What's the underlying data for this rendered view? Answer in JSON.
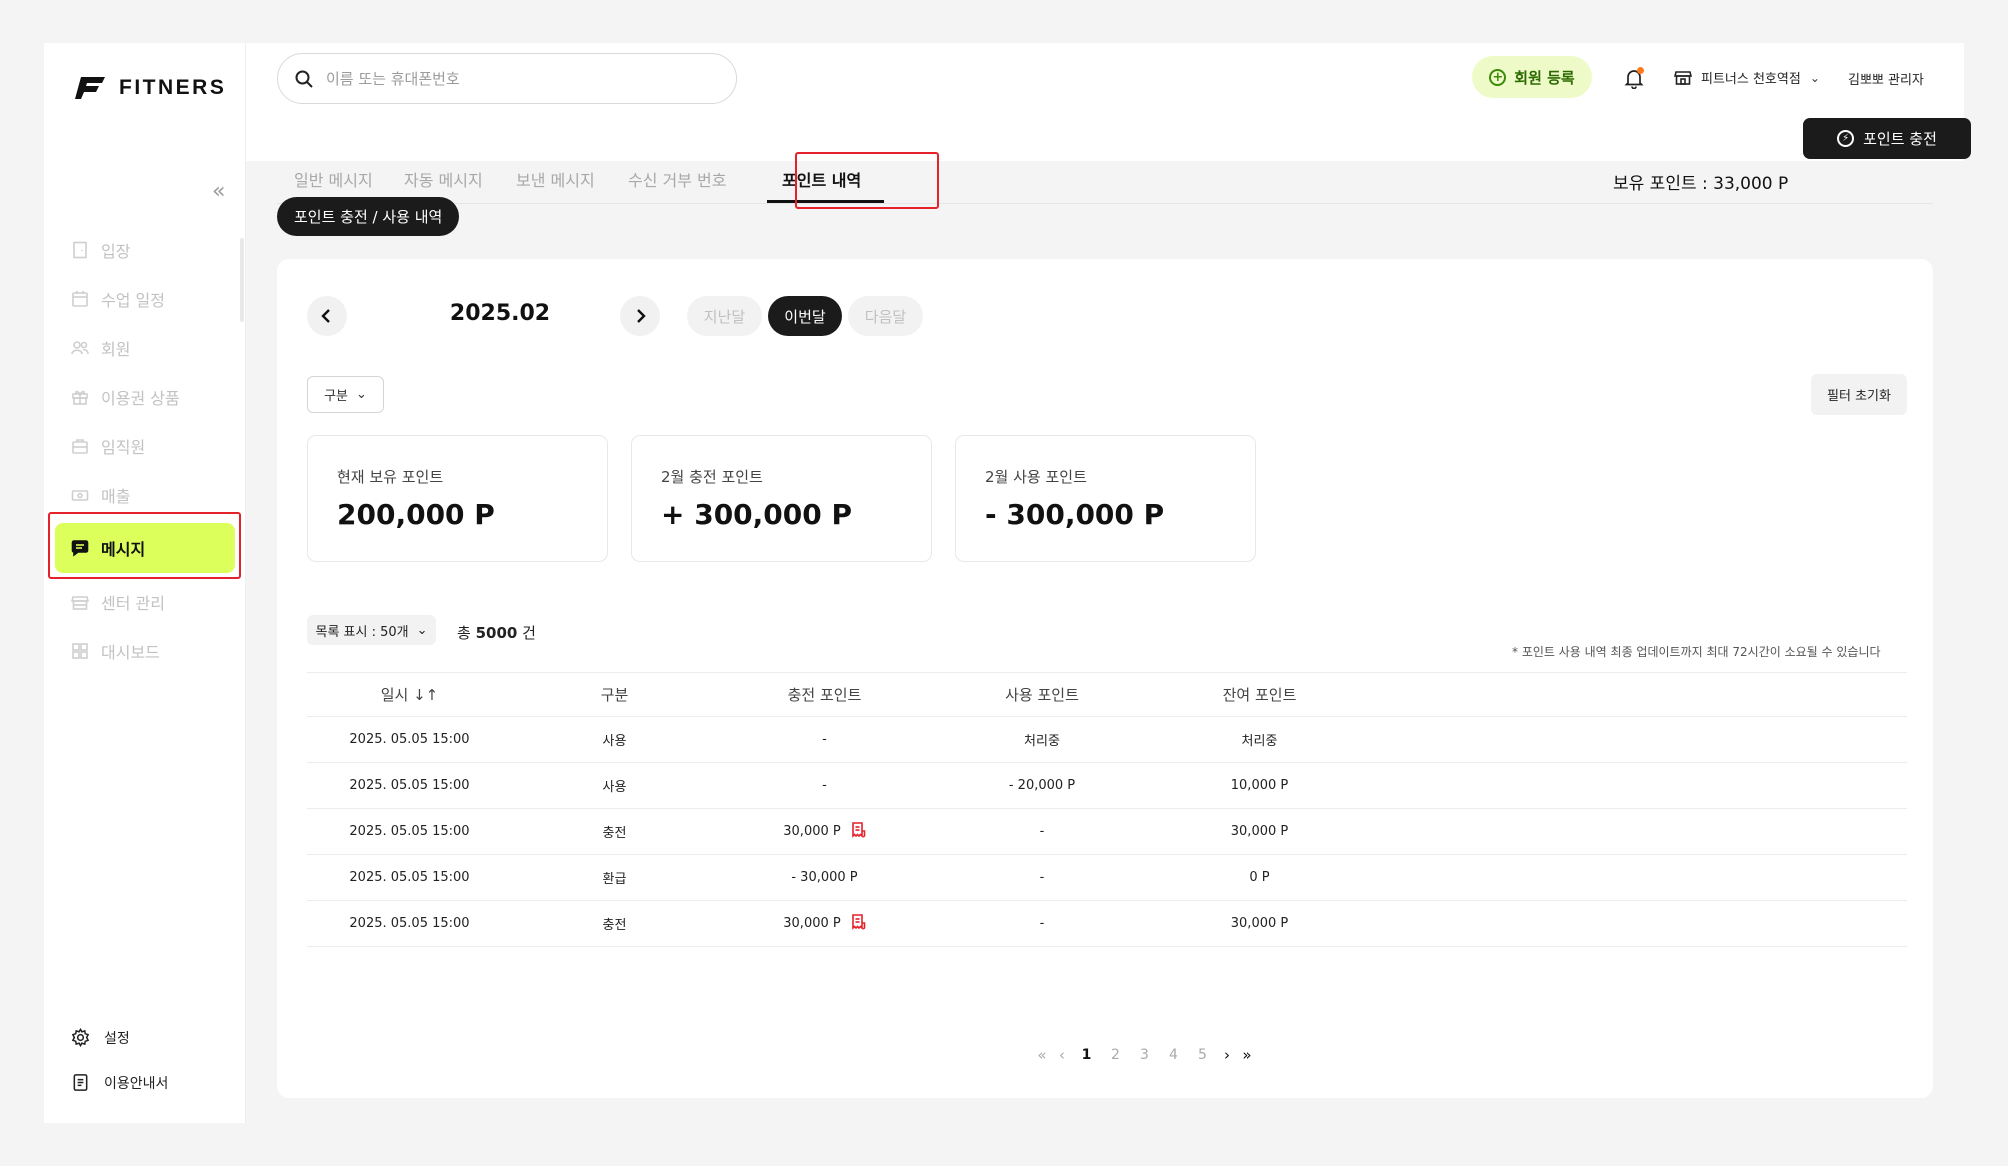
{
  "brand": {
    "name": "FITNERS"
  },
  "sidebar": {
    "items": [
      {
        "label": "입장",
        "icon": "door-icon"
      },
      {
        "label": "수업 일정",
        "icon": "calendar-icon"
      },
      {
        "label": "회원",
        "icon": "members-icon"
      },
      {
        "label": "이용권 상품",
        "icon": "gift-icon"
      },
      {
        "label": "임직원",
        "icon": "briefcase-icon"
      },
      {
        "label": "매출",
        "icon": "cash-icon"
      },
      {
        "label": "메시지",
        "icon": "message-icon",
        "active": true
      },
      {
        "label": "센터 관리",
        "icon": "store-icon"
      },
      {
        "label": "대시보드",
        "icon": "dashboard-icon"
      }
    ],
    "bottom": [
      {
        "label": "설정",
        "icon": "gear-icon"
      },
      {
        "label": "이용안내서",
        "icon": "document-icon"
      }
    ]
  },
  "header": {
    "search_placeholder": "이름 또는 휴대폰번호",
    "register_label": "회원 등록",
    "store_name": "피트너스 천호역점",
    "admin_name": "김뽀뽀 관리자",
    "points_label": "보유 포인트 : 33,000 P",
    "charge_label": "포인트 충전"
  },
  "tabs": [
    "일반 메시지",
    "자동 메시지",
    "보낸 메시지",
    "수신 거부 번호",
    "포인트 내역"
  ],
  "active_tab": "포인트 내역",
  "content": {
    "section_chip": "포인트 충전 / 사용 내역",
    "month": "2025.02",
    "period_buttons": [
      "지난달",
      "이번달",
      "다음달"
    ],
    "active_period": "이번달",
    "filter_label": "구분",
    "reset_label": "필터 초기화",
    "stats": [
      {
        "label": "현재 보유 포인트",
        "value": "200,000 P"
      },
      {
        "label": "2월 충전 포인트",
        "value": "+ 300,000 P"
      },
      {
        "label": "2월 사용 포인트",
        "value": "- 300,000 P"
      }
    ],
    "list_size_label": "목록 표시 : 50개",
    "total_prefix": "총",
    "total_count": "5000",
    "total_suffix": "건",
    "note": "* 포인트 사용 내역 최종 업데이트까지 최대 72시간이 소요될 수 있습니다"
  },
  "table": {
    "headers": [
      "일시 ↓↑",
      "구분",
      "충전 포인트",
      "사용 포인트",
      "잔여 포인트"
    ],
    "rows": [
      {
        "date": "2025. 05.05 15:00",
        "type": "사용",
        "charge": "-",
        "use": "처리중",
        "balance": "처리중",
        "receipt": false
      },
      {
        "date": "2025. 05.05 15:00",
        "type": "사용",
        "charge": "-",
        "use": "- 20,000 P",
        "balance": "10,000 P",
        "receipt": false
      },
      {
        "date": "2025. 05.05 15:00",
        "type": "충전",
        "charge": "30,000 P",
        "use": "-",
        "balance": "30,000 P",
        "receipt": true
      },
      {
        "date": "2025. 05.05 15:00",
        "type": "환급",
        "charge": "- 30,000 P",
        "use": "-",
        "balance": "0 P",
        "receipt": false
      },
      {
        "date": "2025. 05.05 15:00",
        "type": "충전",
        "charge": "30,000 P",
        "use": "-",
        "balance": "30,000 P",
        "receipt": true
      }
    ]
  },
  "pagination": {
    "pages": [
      "1",
      "2",
      "3",
      "4",
      "5"
    ],
    "current": "1"
  },
  "colors": {
    "accent": "#dcff5c",
    "dark": "#1b1b1b",
    "highlight": "#e4222a",
    "register_bg": "#eefbc8"
  }
}
